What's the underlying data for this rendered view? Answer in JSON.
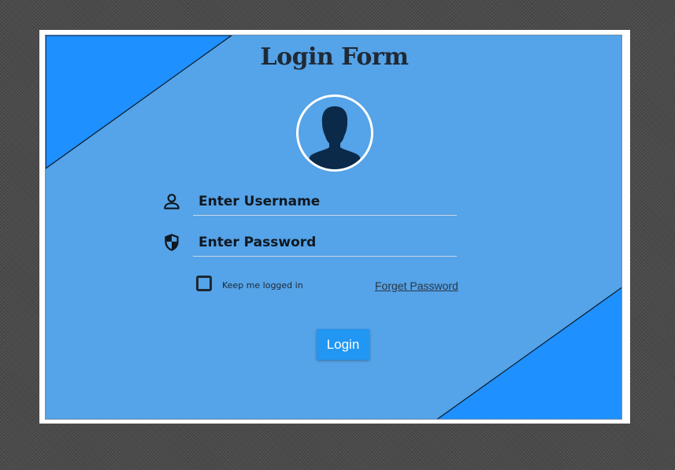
{
  "form": {
    "title": "Login Form",
    "username_placeholder": "Enter Username",
    "password_placeholder": "Enter Password",
    "remember_label": "Keep me logged in",
    "remember_checked": false,
    "forget_link": "Forget Password",
    "login_button": "Login"
  },
  "icons": {
    "avatar": "user-silhouette-icon",
    "username": "person-outline-icon",
    "password": "shield-icon"
  },
  "colors": {
    "panel_background": "#55a3e8",
    "corner_triangles": "#1e90ff",
    "button_background": "#2196f3",
    "avatar_silhouette": "#0b2a4a",
    "page_background": "#4a4a4a"
  }
}
